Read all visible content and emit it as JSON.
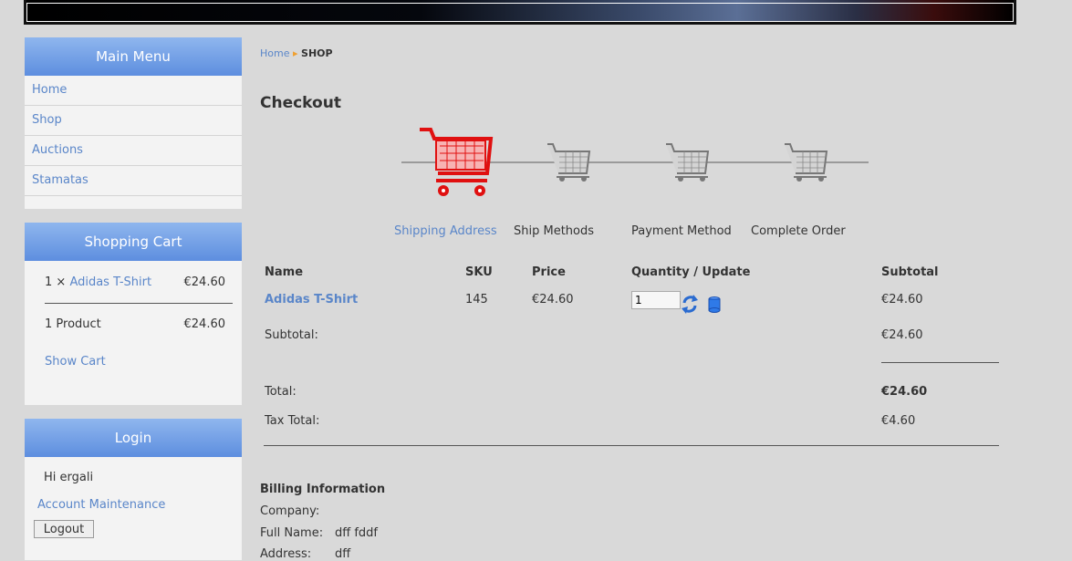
{
  "main_menu": {
    "title": "Main Menu",
    "items": [
      "Home",
      "Shop",
      "Auctions",
      "Stamatas"
    ]
  },
  "shopping_cart": {
    "title": "Shopping Cart",
    "item_qty": "1 ×",
    "item_name": "Adidas T-Shirt",
    "item_price": "€24.60",
    "summary_label": "1 Product",
    "summary_price": "€24.60",
    "show_cart": "Show Cart"
  },
  "login": {
    "title": "Login",
    "greeting": "Hi ergali",
    "account": "Account Maintenance",
    "logout": "Logout"
  },
  "breadcrumb": {
    "home": "Home",
    "separator": "▸",
    "current": "SHOP"
  },
  "page_title": "Checkout",
  "steps": [
    {
      "label": "Shipping Address",
      "active": true
    },
    {
      "label": "Ship Methods",
      "active": false
    },
    {
      "label": "Payment Method",
      "active": false
    },
    {
      "label": "Complete Order",
      "active": false
    }
  ],
  "table": {
    "headers": {
      "name": "Name",
      "sku": "SKU",
      "price": "Price",
      "qty": "Quantity / Update",
      "subtotal": "Subtotal"
    },
    "row": {
      "name": "Adidas T-Shirt",
      "sku": "145",
      "price": "€24.60",
      "qty": "1",
      "subtotal": "€24.60"
    },
    "subtotal_label": "Subtotal:",
    "subtotal_value": "€24.60",
    "total_label": "Total:",
    "total_value": "€24.60",
    "tax_label": "Tax Total:",
    "tax_value": "€4.60"
  },
  "billing": {
    "title": "Billing Information",
    "company_label": "Company:",
    "fullname_label": "Full Name:",
    "fullname_value": "dff fddf",
    "address_label": "Address:",
    "address_value": "dff"
  },
  "colors": {
    "link": "#5a86c9",
    "menu_header": "#6e9ce6",
    "cart_active": "#e01010",
    "cart_inactive": "#888888"
  }
}
